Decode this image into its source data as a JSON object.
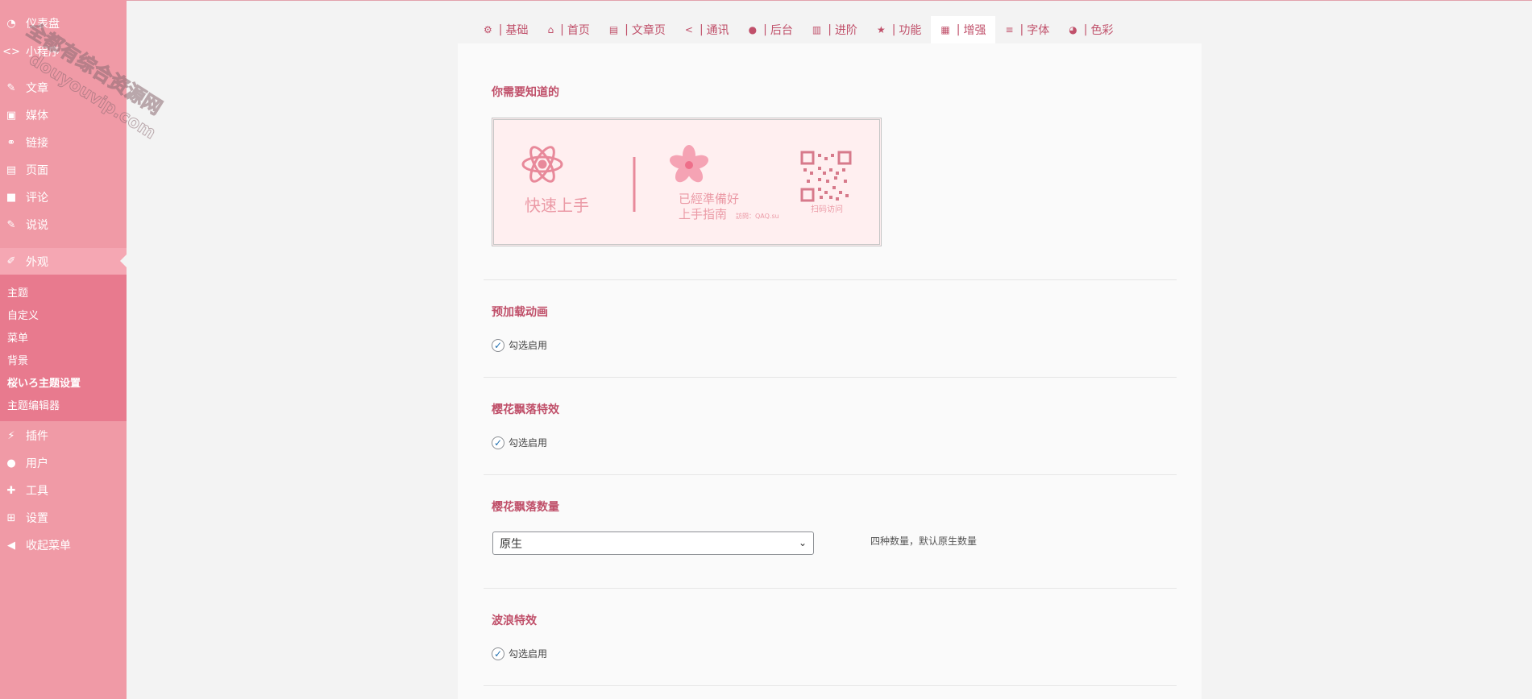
{
  "sidebar": {
    "items_top": [
      {
        "label": "仪表盘",
        "icon": "dashboard-icon"
      },
      {
        "label": "小程序",
        "icon": "code-icon"
      },
      {
        "label": "文章",
        "icon": "pin-icon"
      },
      {
        "label": "媒体",
        "icon": "media-icon"
      },
      {
        "label": "链接",
        "icon": "link-icon"
      },
      {
        "label": "页面",
        "icon": "pages-icon"
      },
      {
        "label": "评论",
        "icon": "comment-icon"
      },
      {
        "label": "说说",
        "icon": "pin-icon"
      },
      {
        "label": "外观",
        "icon": "brush-icon"
      }
    ],
    "submenu": [
      "主题",
      "自定义",
      "菜单",
      "背景",
      "桜いろ主题设置",
      "主题编辑器"
    ],
    "items_bottom": [
      {
        "label": "插件",
        "icon": "plugin-icon"
      },
      {
        "label": "用户",
        "icon": "user-icon"
      },
      {
        "label": "工具",
        "icon": "wrench-icon"
      },
      {
        "label": "设置",
        "icon": "settings-icon"
      },
      {
        "label": "收起菜单",
        "icon": "collapse-icon"
      }
    ]
  },
  "watermark": {
    "line1": "全都有综合资源网",
    "line2": "douyouvip.com"
  },
  "tabs": [
    {
      "label": "基础",
      "icon": "gear-icon"
    },
    {
      "label": "首页",
      "icon": "home-icon"
    },
    {
      "label": "文章页",
      "icon": "article-icon"
    },
    {
      "label": "通讯",
      "icon": "share-icon"
    },
    {
      "label": "后台",
      "icon": "user-icon"
    },
    {
      "label": "进阶",
      "icon": "book-icon"
    },
    {
      "label": "功能",
      "icon": "star-icon"
    },
    {
      "label": "增强",
      "icon": "grid-icon"
    },
    {
      "label": "字体",
      "icon": "list-icon"
    },
    {
      "label": "色彩",
      "icon": "palette-icon"
    }
  ],
  "active_tab": "增强",
  "banner": {
    "quick_start": "快速上手",
    "ready": "已經準備好",
    "guide": "上手指南",
    "visit": "訪問：QAQ.su",
    "scan": "扫码访问"
  },
  "sections": {
    "info_title": "你需要知道的",
    "preload_title": "预加载动画",
    "preload_check": "勾选启用",
    "sakura_title": "樱花飘落特效",
    "sakura_check": "勾选启用",
    "sakura_count_title": "樱花飘落数量",
    "sakura_count_value": "原生",
    "sakura_count_desc": "四种数量，默认原生数量",
    "wave_title": "波浪特效",
    "wave_check": "勾选启用"
  },
  "colors": {
    "sidebar": "#f09aa6",
    "submenu": "#e87a8e",
    "accent": "#c0506a",
    "banner_bg": "#ffeff0"
  }
}
